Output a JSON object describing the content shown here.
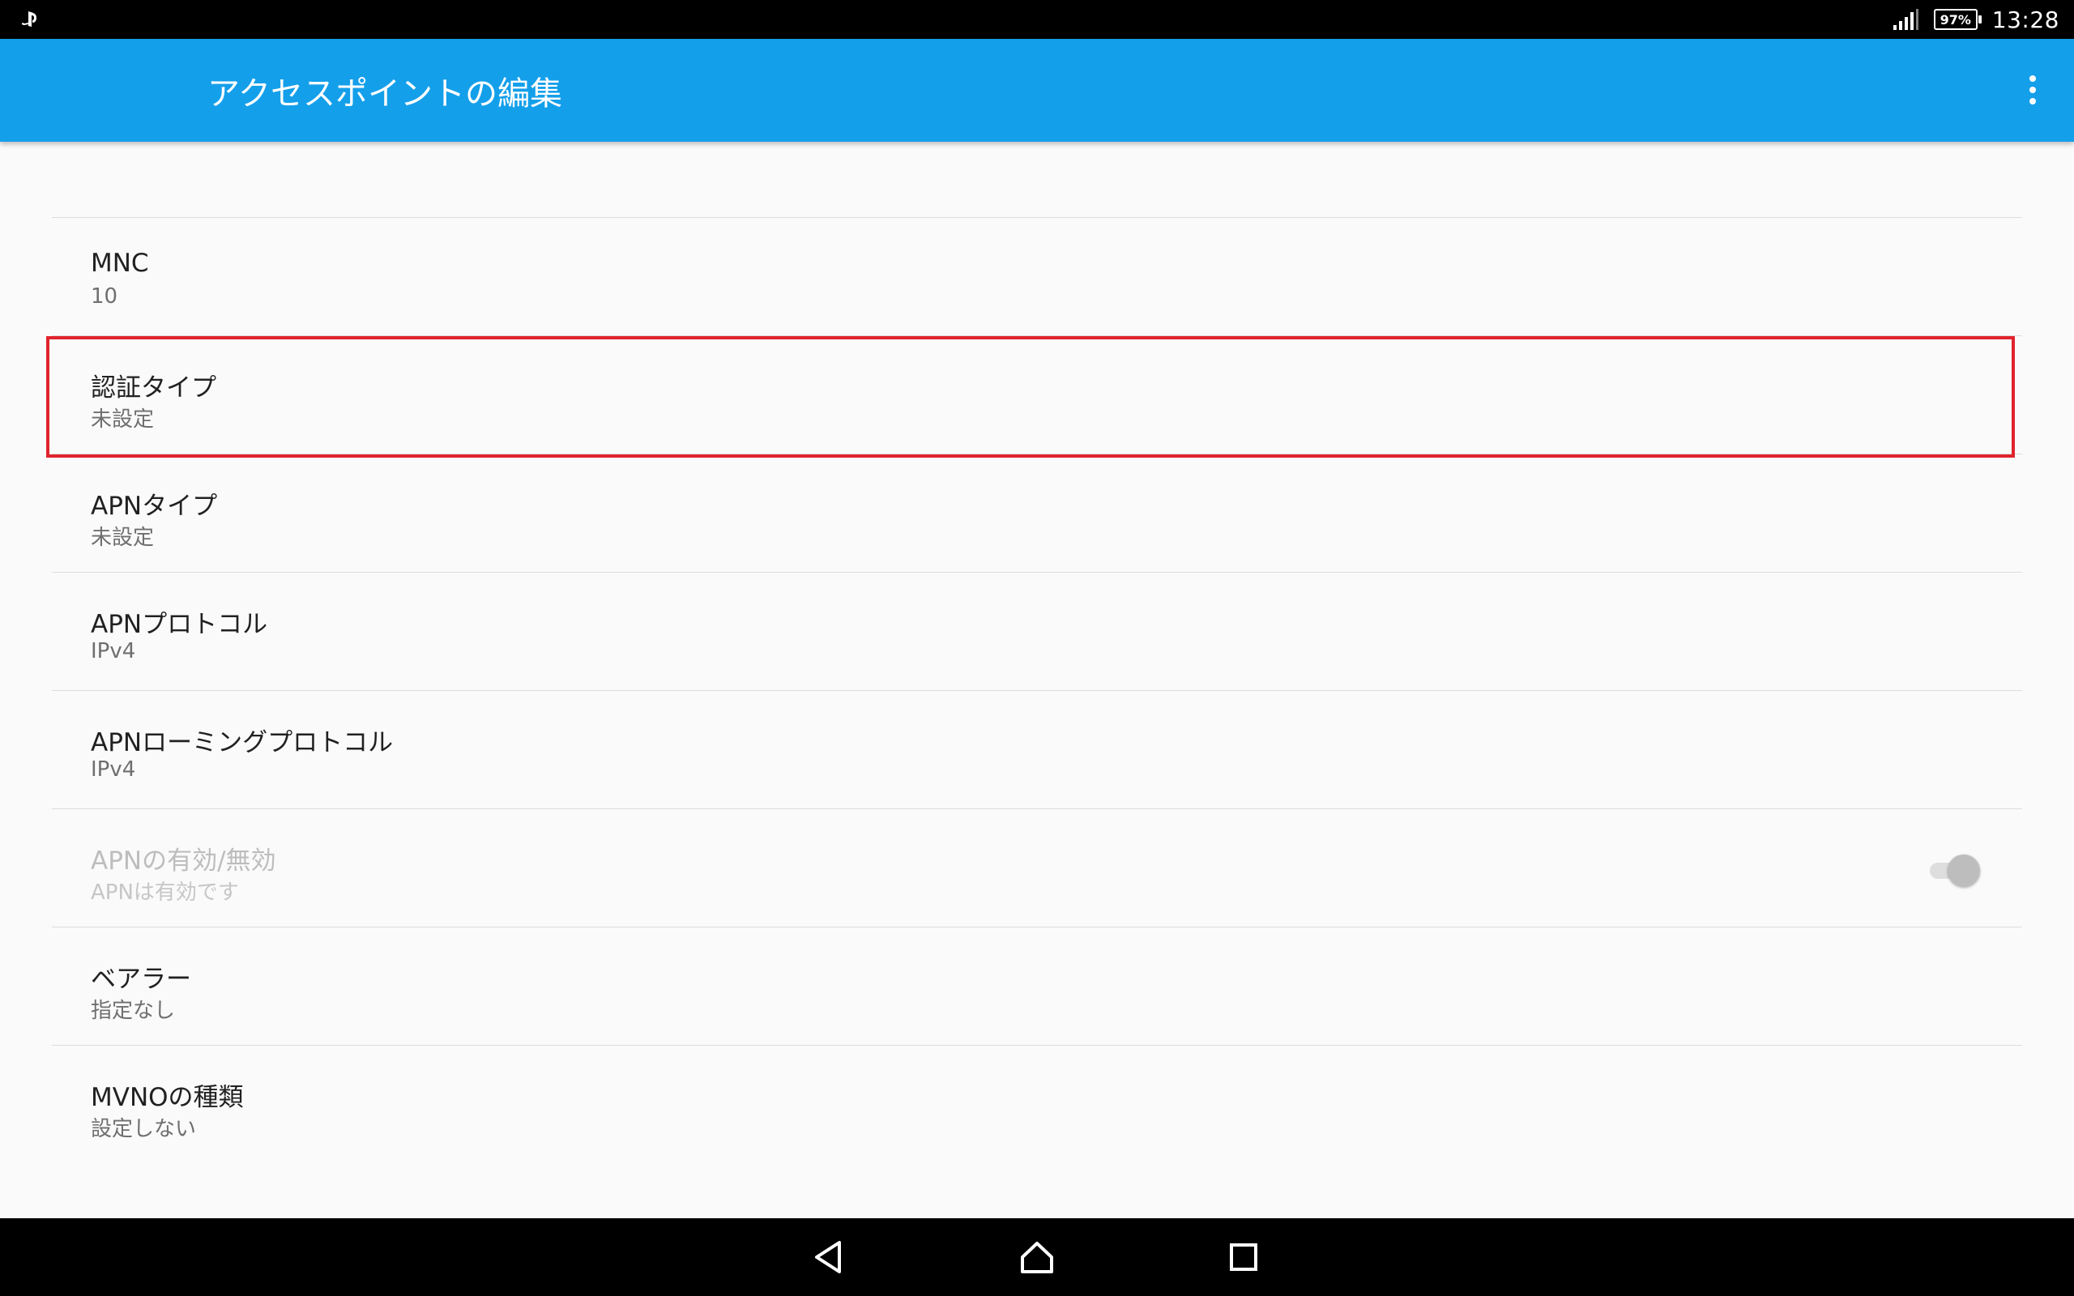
{
  "status_bar": {
    "time": "13:28",
    "battery_percent": "97%",
    "left_icon": "playstation-icon",
    "signal_icon": "signal-icon"
  },
  "app_bar": {
    "title": "アクセスポイントの編集",
    "overflow_icon": "more-vert-icon"
  },
  "settings": [
    {
      "label": "MNC",
      "value": "10"
    },
    {
      "label": "認証タイプ",
      "value": "未設定"
    },
    {
      "label": "APNタイプ",
      "value": "未設定"
    },
    {
      "label": "APNプロトコル",
      "value": "IPv4"
    },
    {
      "label": "APNローミングプロトコル",
      "value": "IPv4"
    },
    {
      "label": "APNの有効/無効",
      "value": "APNは有効です",
      "enabled": false,
      "toggle_on": true
    },
    {
      "label": "ベアラー",
      "value": "指定なし"
    },
    {
      "label": "MVNOの種類",
      "value": "設定しない"
    }
  ],
  "highlight_color": "#e0242d",
  "accent_color": "#149fea",
  "nav_bar": {
    "back_icon": "back-icon",
    "home_icon": "home-icon",
    "recents_icon": "recents-icon"
  }
}
